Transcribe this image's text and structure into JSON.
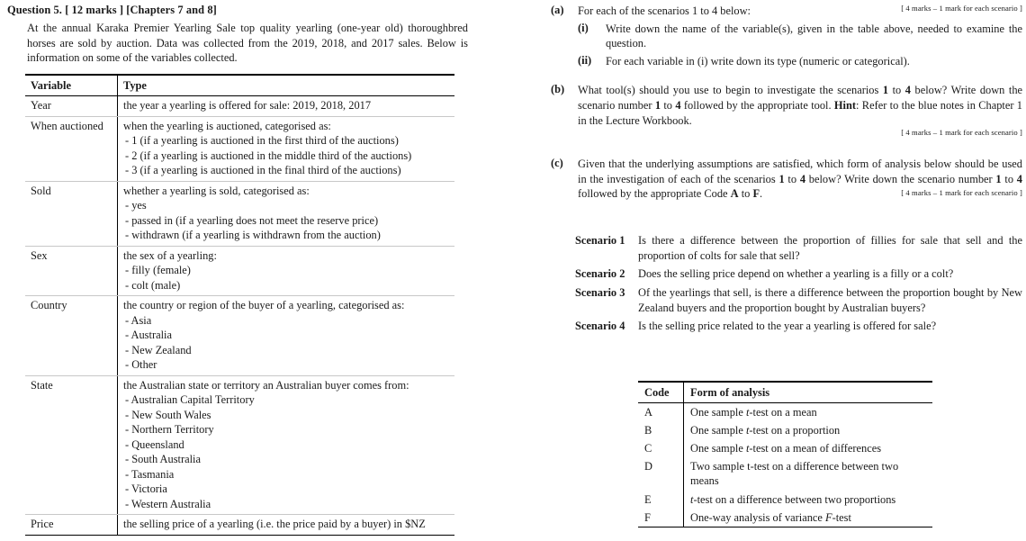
{
  "question": {
    "heading": "Question 5. [ 12 marks ] [Chapters 7 and 8]",
    "intro": "At the annual Karaka Premier Yearling Sale top quality yearling (one-year old) thoroughbred horses are sold by auction. Data was collected from the 2019, 2018, and 2017 sales. Below is information on some of the variables collected."
  },
  "variable_table": {
    "headers": [
      "Variable",
      "Type"
    ],
    "rows": [
      {
        "variable": "Year",
        "desc": "the year a yearling is offered for sale: 2019, 2018, 2017",
        "items": []
      },
      {
        "variable": "When auctioned",
        "desc": "when the yearling is auctioned, categorised as:",
        "items": [
          "- 1 (if a yearling is auctioned in the first third of the auctions)",
          "- 2 (if a yearling is auctioned in the middle third of the auctions)",
          "- 3 (if a yearling is auctioned in the final third of the auctions)"
        ]
      },
      {
        "variable": "Sold",
        "desc": "whether a yearling is sold, categorised as:",
        "items": [
          "- yes",
          "- passed in (if a yearling does not meet the reserve price)",
          "- withdrawn (if a yearling is withdrawn from the auction)"
        ]
      },
      {
        "variable": "Sex",
        "desc": "the sex of a yearling:",
        "items": [
          "- filly (female)",
          "- colt (male)"
        ]
      },
      {
        "variable": "Country",
        "desc": "the country or region of the buyer of a yearling, categorised as:",
        "items": [
          "- Asia",
          "- Australia",
          "- New Zealand",
          "- Other"
        ]
      },
      {
        "variable": "State",
        "desc": "the Australian state or territory an Australian buyer comes from:",
        "items": [
          "- Australian Capital Territory",
          "- New South Wales",
          "- Northern Territory",
          "- Queensland",
          "- South Australia",
          "- Tasmania",
          "- Victoria",
          "- Western Australia"
        ]
      },
      {
        "variable": "Price",
        "desc": "the selling price of a yearling (i.e. the price paid by a buyer) in $NZ",
        "items": []
      }
    ]
  },
  "parts": {
    "a": {
      "label": "(a)",
      "stem": "For each of the scenarios 1 to 4 below:",
      "marks": "[ 4 marks – 1 mark for each scenario ]",
      "i": {
        "label": "(i)",
        "text": "Write down the name of the variable(s), given in the table above, needed to examine the question."
      },
      "ii": {
        "label": "(ii)",
        "text": "For each variable in (i) write down its type (numeric or categorical)."
      }
    },
    "b": {
      "label": "(b)",
      "text_1": "What tool(s) should you use to begin to investigate the scenarios ",
      "bold_1": "1",
      "text_2": " to ",
      "bold_2": "4",
      "text_3": " below? Write down the scenario number ",
      "bold_3": "1",
      "text_4": " to ",
      "bold_4": "4",
      "text_5": " followed by the appropriate tool. ",
      "hint_label": "Hint",
      "text_6": ": Refer to the blue notes in Chapter 1 in the Lecture Workbook.",
      "marks": "[ 4 marks – 1 mark for each scenario ]"
    },
    "c": {
      "label": "(c)",
      "text_1": "Given that the underlying assumptions are satisfied, which form of analysis below should be used in the investigation of each of the scenarios ",
      "bold_1": "1",
      "text_2": " to ",
      "bold_2": "4",
      "text_3": " below? Write down the scenario number ",
      "bold_3": "1",
      "text_4": " to ",
      "bold_4": "4",
      "text_5": " followed by the appropriate Code ",
      "bold_5": "A",
      "text_6": " to ",
      "bold_6": "F",
      "text_7": ".",
      "marks": "[ 4 marks – 1 mark for each scenario ]"
    }
  },
  "scenarios": [
    {
      "label": "Scenario 1",
      "text": "Is there a difference between the proportion of fillies for sale that sell and the proportion of colts for sale that sell?"
    },
    {
      "label": "Scenario 2",
      "text": "Does the selling price depend on whether a yearling is a filly or a colt?"
    },
    {
      "label": "Scenario 3",
      "text": "Of the yearlings that sell, is there a difference between the proportion bought by New Zealand buyers and the proportion bought by Australian buyers?"
    },
    {
      "label": "Scenario 4",
      "text": "Is the selling price related to the year a yearling is offered for sale?"
    }
  ],
  "code_table": {
    "headers": [
      "Code",
      "Form of analysis"
    ],
    "rows": [
      {
        "code": "A",
        "pre": "One sample ",
        "ital": "t",
        "post": "-test on a mean"
      },
      {
        "code": "B",
        "pre": "One sample ",
        "ital": "t",
        "post": "-test on a proportion"
      },
      {
        "code": "C",
        "pre": "One sample ",
        "ital": "t",
        "post": "-test on a mean of differences"
      },
      {
        "code": "D",
        "pre": "Two sample t-test on a difference between two means",
        "ital": "",
        "post": ""
      },
      {
        "code": "E",
        "pre": "",
        "ital": "t",
        "post": "-test on a difference between two proportions"
      },
      {
        "code": "F",
        "pre": "One-way analysis of variance ",
        "ital": "F",
        "post": "-test"
      }
    ]
  }
}
